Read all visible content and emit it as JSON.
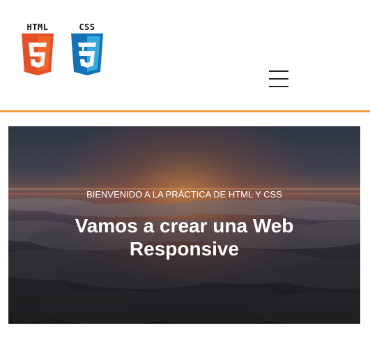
{
  "header": {
    "logos": [
      {
        "label": "HTML",
        "number": "5",
        "icon": "html5-icon",
        "color": "#e34f26"
      },
      {
        "label": "CSS",
        "number": "3",
        "icon": "css3-icon",
        "color": "#1572b6"
      }
    ],
    "menu_icon": "hamburger-menu-icon",
    "accent_color": "#f2a33a"
  },
  "hero": {
    "kicker": "BIENVENIDO A LA PRÁCTICA DE HTML Y CSS",
    "title_line_1": "Vamos a crear una Web",
    "title_line_2": "Responsive"
  }
}
